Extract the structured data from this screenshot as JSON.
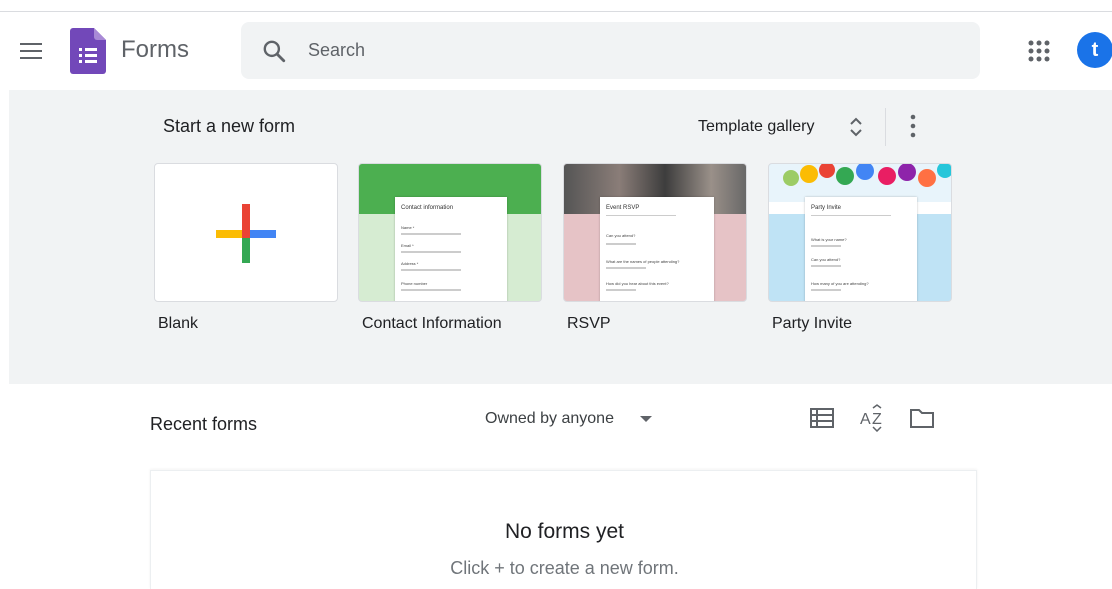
{
  "header": {
    "app_title": "Forms",
    "search_placeholder": "Search",
    "avatar_letter": "t",
    "icons": [
      "main-menu-icon",
      "forms-logo-icon",
      "search-icon",
      "apps-grid-icon"
    ],
    "colors": {
      "logo": "#7248b9",
      "avatar": "#1a73e8"
    }
  },
  "templates": {
    "title": "Start a new form",
    "gallery_label": "Template gallery",
    "items": [
      {
        "label": "Blank"
      },
      {
        "label": "Contact Information",
        "card_title": "Contact information",
        "fields": [
          "Name *",
          "Email *",
          "Address *",
          "Phone number"
        ]
      },
      {
        "label": "RSVP",
        "card_title": "Event RSVP",
        "fields": [
          "Can you attend?",
          "What are the names of people attending?",
          "How did you hear about this event?"
        ]
      },
      {
        "label": "Party Invite",
        "card_title": "Party Invite",
        "fields": [
          "What is your name?",
          "Can you attend?",
          "How many of you are attending?"
        ]
      }
    ],
    "band_color": "#f1f3f4"
  },
  "recent": {
    "title": "Recent forms",
    "owner_filter": "Owned by anyone",
    "view_icons": [
      "list-view-icon",
      "sort-az-icon",
      "folder-icon"
    ],
    "empty_title": "No forms yet",
    "empty_subtitle": "Click + to create a new form."
  }
}
